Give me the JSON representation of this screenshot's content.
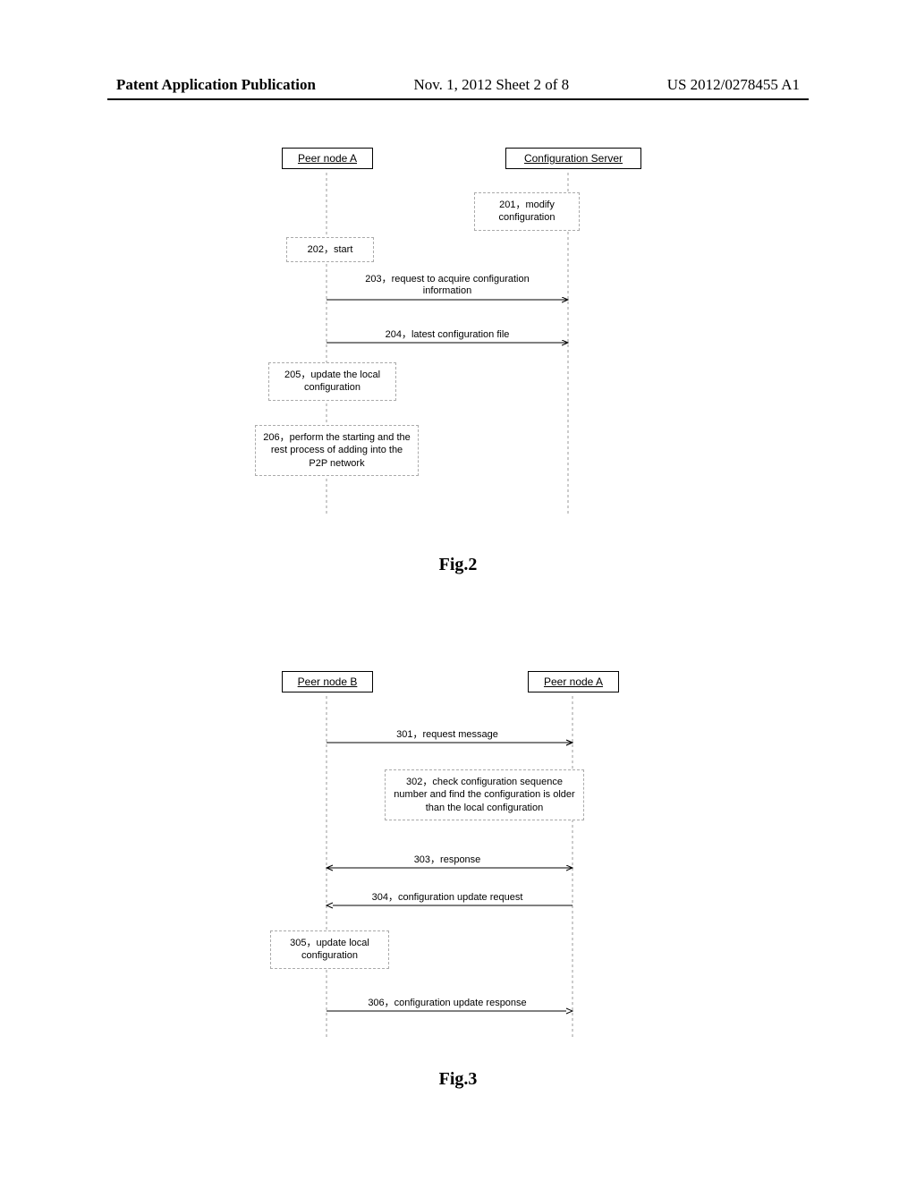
{
  "header": {
    "left": "Patent Application Publication",
    "center": "Nov. 1, 2012  Sheet 2 of 8",
    "right": "US 2012/0278455 A1"
  },
  "fig2": {
    "label": "Fig.2",
    "actors": {
      "left": "Peer node A",
      "right": "Configuration Server"
    },
    "steps": {
      "s201": "201，modify configuration",
      "s202": "202，start",
      "s203": "203，request to acquire configuration information",
      "s204": "204，latest configuration file",
      "s205": "205，update the local configuration",
      "s206": "206，perform the starting and the rest process of adding into the P2P network"
    }
  },
  "fig3": {
    "label": "Fig.3",
    "actors": {
      "left": "Peer node B",
      "right": "Peer node A"
    },
    "steps": {
      "s301": "301，request message",
      "s302": "302，check configuration sequence number and find the configuration is older than the local configuration",
      "s303": "303，response",
      "s304": "304，configuration update request",
      "s305": "305，update local configuration",
      "s306": "306，configuration update response"
    }
  }
}
